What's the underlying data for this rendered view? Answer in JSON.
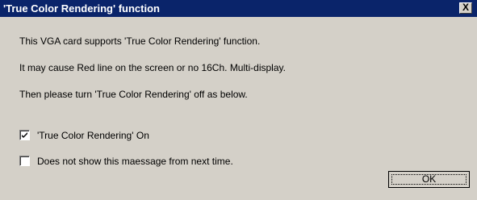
{
  "window": {
    "title": "'True Color Rendering' function",
    "close_glyph": "X"
  },
  "messages": [
    "This VGA card supports 'True Color Rendering' function.",
    "It may cause Red line on the screen or no 16Ch. Multi-display.",
    "Then please turn 'True Color Rendering' off as below."
  ],
  "checkboxes": [
    {
      "label": "'True Color Rendering' On",
      "checked": true
    },
    {
      "label": "Does not show this maessage from next time.",
      "checked": false
    }
  ],
  "buttons": {
    "ok_label": "OK"
  }
}
